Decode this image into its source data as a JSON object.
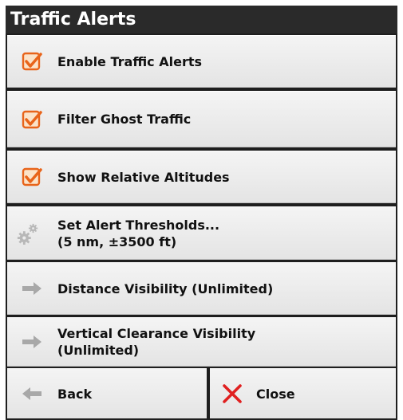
{
  "title": "Traffic Alerts",
  "items": [
    {
      "label": "Enable Traffic Alerts",
      "icon": "checkbox-checked-icon",
      "checked": true
    },
    {
      "label": "Filter Ghost Traffic",
      "icon": "checkbox-checked-icon",
      "checked": true
    },
    {
      "label": "Show Relative Altitudes",
      "icon": "checkbox-checked-icon",
      "checked": true
    },
    {
      "label_line1": "Set Alert Thresholds...",
      "label_line2": "(5 nm, ±3500 ft)",
      "icon": "gears-icon"
    },
    {
      "label": "Distance Visibility (Unlimited)",
      "icon": "arrow-right-icon"
    },
    {
      "label_line1": "Vertical Clearance Visibility",
      "label_line2": "(Unlimited)",
      "icon": "arrow-right-icon"
    }
  ],
  "buttons": {
    "back": "Back",
    "close": "Close"
  },
  "colors": {
    "accent": "#e8641a",
    "close_x": "#e02020",
    "arrow": "#a8a8a8",
    "panel": "#1e1e1e"
  }
}
